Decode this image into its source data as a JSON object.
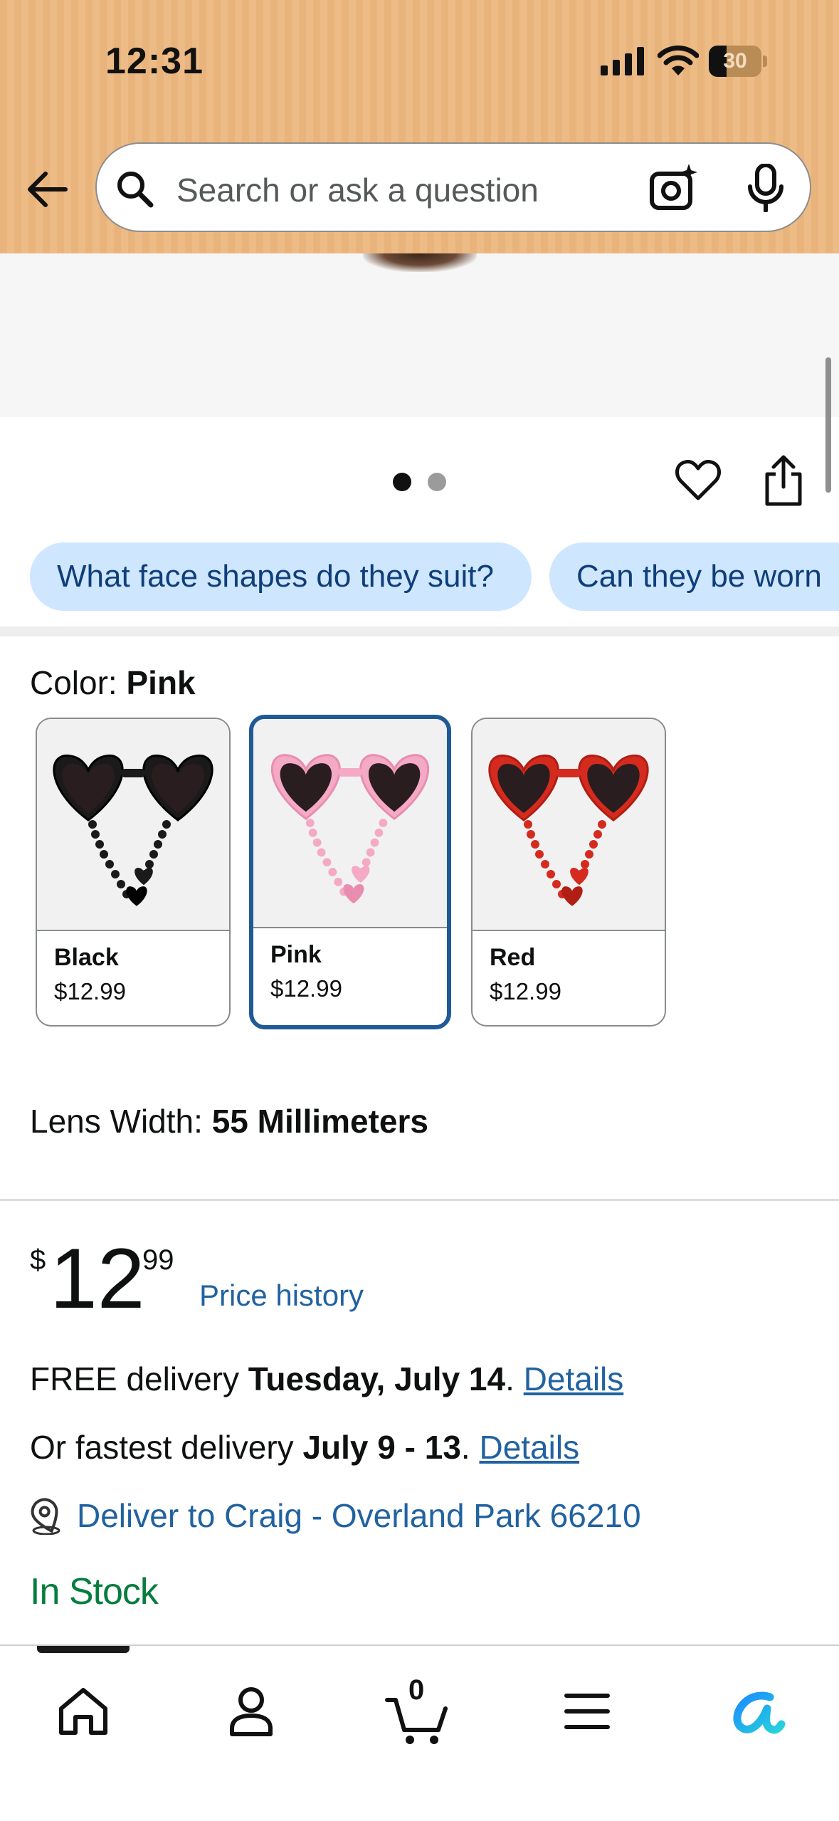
{
  "status_bar": {
    "time": "12:31",
    "battery": "30"
  },
  "search": {
    "placeholder": "Search or ask a question"
  },
  "gallery": {
    "dots": 2,
    "active_dot": 1
  },
  "chips": [
    "What face shapes do they suit?",
    "Can they be worn"
  ],
  "color": {
    "label": "Color: ",
    "selected": "Pink",
    "options": [
      {
        "name": "Black",
        "price": "$12.99",
        "frame": "#1a1a1a",
        "frame_dark": "#000000"
      },
      {
        "name": "Pink",
        "price": "$12.99",
        "frame": "#f4a9c4",
        "frame_dark": "#e98db0"
      },
      {
        "name": "Red",
        "price": "$12.99",
        "frame": "#d52b1e",
        "frame_dark": "#b01e14"
      }
    ]
  },
  "lens_width": {
    "label": "Lens Width: ",
    "value": "55 Millimeters"
  },
  "price": {
    "symbol": "$",
    "whole": "12",
    "fraction": "99",
    "history_link": "Price history"
  },
  "delivery": {
    "free_prefix": "FREE delivery ",
    "free_date": "Tuesday, July 14",
    "period": ".",
    "details_1": "Details",
    "fast_prefix": "Or fastest delivery ",
    "fast_date": "July 9 - 13",
    "details_2": "Details",
    "deliver_to": "Deliver to Craig - Overland Park 66210"
  },
  "stock": "In Stock",
  "tabbar": {
    "cart_count": "0"
  },
  "colors": {
    "accent_link": "#2162a1",
    "chip_bg": "#cfe6ff",
    "in_stock": "#067d3e",
    "selected_border": "#1f5a96"
  }
}
